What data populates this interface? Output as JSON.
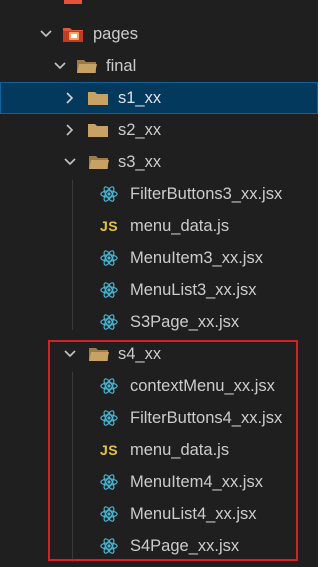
{
  "explorer": {
    "items": [
      {
        "label": "pages",
        "type": "folder-special",
        "expanded": true
      },
      {
        "label": "final",
        "type": "folder",
        "expanded": true
      },
      {
        "label": "s1_xx",
        "type": "folder",
        "expanded": false,
        "selected": true
      },
      {
        "label": "s2_xx",
        "type": "folder",
        "expanded": false
      },
      {
        "label": "s3_xx",
        "type": "folder",
        "expanded": true
      },
      {
        "label": "FilterButtons3_xx.jsx",
        "type": "react"
      },
      {
        "label": "menu_data.js",
        "type": "js"
      },
      {
        "label": "MenuItem3_xx.jsx",
        "type": "react"
      },
      {
        "label": "MenuList3_xx.jsx",
        "type": "react"
      },
      {
        "label": "S3Page_xx.jsx",
        "type": "react"
      },
      {
        "label": "s4_xx",
        "type": "folder",
        "expanded": true
      },
      {
        "label": "contextMenu_xx.jsx",
        "type": "react"
      },
      {
        "label": "FilterButtons4_xx.jsx",
        "type": "react"
      },
      {
        "label": "menu_data.js",
        "type": "js"
      },
      {
        "label": "MenuItem4_xx.jsx",
        "type": "react"
      },
      {
        "label": "MenuList4_xx.jsx",
        "type": "react"
      },
      {
        "label": "S4Page_xx.jsx",
        "type": "react"
      }
    ],
    "js_badge": "JS"
  },
  "colors": {
    "background": "#1f1f1f",
    "text": "#cccccc",
    "selected_row": "#04395e",
    "folder": "#c8a165",
    "react": "#4fb6d6",
    "js": "#e8c340",
    "special_folder": "#e2553a",
    "annotation_box": "#d4202a"
  }
}
